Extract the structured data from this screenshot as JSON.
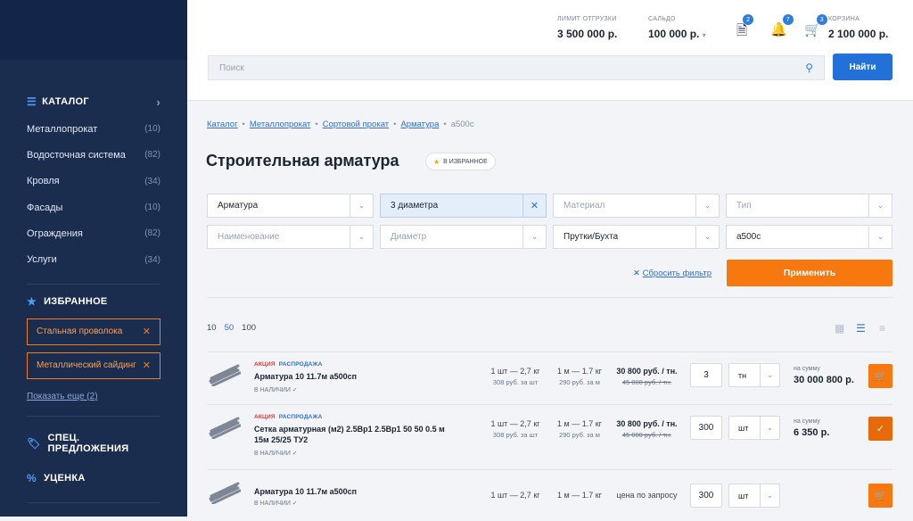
{
  "sidebar": {
    "catalog_label": "КАТАЛОГ",
    "categories": [
      {
        "label": "Металлопрокат",
        "count": "(10)"
      },
      {
        "label": "Водосточная система",
        "count": "(82)"
      },
      {
        "label": "Кровля",
        "count": "(34)"
      },
      {
        "label": "Фасады",
        "count": "(10)"
      },
      {
        "label": "Ограждения",
        "count": "(82)"
      },
      {
        "label": "Услуги",
        "count": "(34)"
      }
    ],
    "favorites_label": "ИЗБРАННОЕ",
    "favorites": [
      "Стальная проволока",
      "Металлический сайдинг"
    ],
    "show_more": "Показать еще (2)",
    "special_label": "СПЕЦ. ПРЕДЛОЖЕНИЯ",
    "discount_label": "УЦЕНКА"
  },
  "header": {
    "limit_label": "ЛИМИТ ОТГРУЗКИ",
    "limit_value": "3 500 000 р.",
    "saldo_label": "САЛЬДО",
    "saldo_value": "100 000 р.",
    "docs_badge": "2",
    "notif_badge": "7",
    "cart_badge": "3",
    "cart_label": "КОРЗИНА",
    "cart_value": "2 100 000 р.",
    "search_placeholder": "Поиск",
    "search_button": "Найти"
  },
  "breadcrumb": [
    "Каталог",
    "Металлопрокат",
    "Сортовой прокат",
    "Арматура",
    "а500с"
  ],
  "page_title": "Строительная арматура",
  "fav_button": "В ИЗБРАННОЕ",
  "filters": {
    "f1": "Арматура",
    "f2": "3 диаметра",
    "f3": "Материал",
    "f4": "Тип",
    "f5": "Наименование",
    "f6": "Диаметр",
    "f7": "Прутки/Бухта",
    "f8": "а500с",
    "reset": "Сбросить фильтр",
    "apply": "Применить"
  },
  "per_page": [
    "10",
    "50",
    "100"
  ],
  "products": [
    {
      "tag1": "АКЦИЯ",
      "tag2": "РАСПРОДАЖА",
      "name": "Арматура 10 11.7м а500сп",
      "stock": "В НАЛИЧИИ ✓",
      "per_piece": "1 шт — 2,7 кг",
      "per_piece_price": "308 руб. за шт",
      "per_meter": "1 м — 1.7 кг",
      "per_meter_price": "290 руб. за м",
      "price": "30 800 руб. / тн.",
      "old_price": "45 000 руб. / тн.",
      "qty": "3",
      "unit": "тн",
      "sum_label": "на сумму",
      "sum": "30 000 800 р."
    },
    {
      "tag1": "АКЦИЯ",
      "tag2": "РАСПРОДАЖА",
      "name": "Сетка арматурная (м2) 2.5Вр1 2.5Вр1 50 50 0.5 м 15м 25/25 ТУ2",
      "stock": "В НАЛИЧИИ ✓",
      "per_piece": "1 шт — 2,7 кг",
      "per_piece_price": "308 руб. за шт",
      "per_meter": "1 м — 1.7 кг",
      "per_meter_price": "290 руб. за м",
      "price": "30 800 руб. / тн.",
      "old_price": "45 000 руб. / тн.",
      "qty": "300",
      "unit": "шт",
      "sum_label": "на сумму",
      "sum": "6 350 р."
    },
    {
      "name": "Арматура 10 11.7м а500сп",
      "stock": "В НАЛИЧИИ ✓",
      "per_piece": "1 шт — 2,7 кг",
      "per_meter": "1 м — 1.7 кг",
      "price": "цена по запросу",
      "qty": "300",
      "unit": "шт"
    }
  ]
}
